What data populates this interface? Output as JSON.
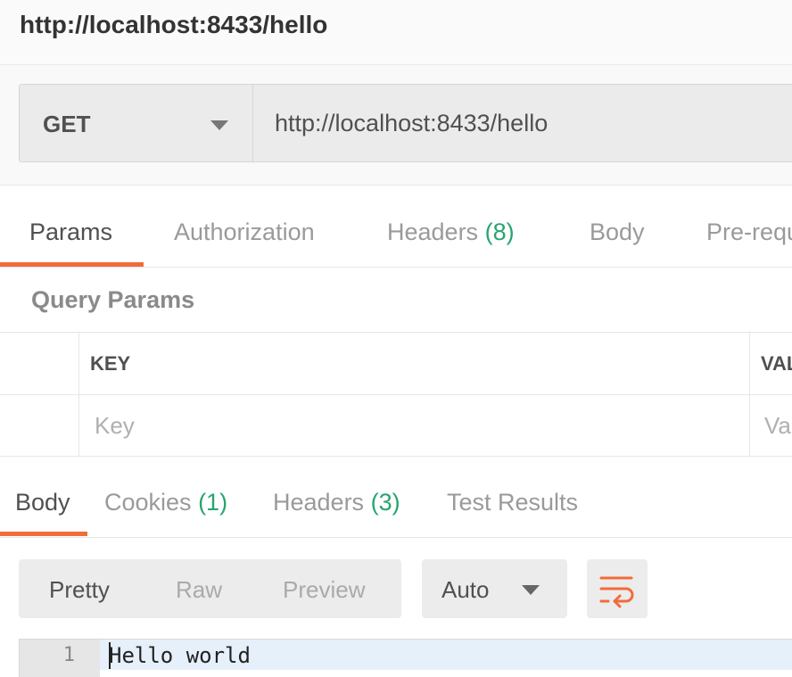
{
  "window": {
    "title": "http://localhost:8433/hello"
  },
  "request": {
    "method": "GET",
    "url": "http://localhost:8433/hello"
  },
  "request_tabs": [
    {
      "label": "Params",
      "count": "",
      "active": true
    },
    {
      "label": "Authorization",
      "count": "",
      "active": false
    },
    {
      "label": "Headers",
      "count": "(8)",
      "active": false
    },
    {
      "label": "Body",
      "count": "",
      "active": false
    },
    {
      "label": "Pre-requ",
      "count": "",
      "active": false
    }
  ],
  "query_params": {
    "title": "Query Params",
    "columns": [
      "KEY",
      "VAL"
    ],
    "placeholder_row": [
      "Key",
      "Va"
    ]
  },
  "response_tabs": [
    {
      "label": "Body",
      "count": "",
      "active": true
    },
    {
      "label": "Cookies",
      "count": "(1)",
      "active": false
    },
    {
      "label": "Headers",
      "count": "(3)",
      "active": false
    },
    {
      "label": "Test Results",
      "count": "",
      "active": false
    }
  ],
  "response_toolbar": {
    "view_modes": [
      "Pretty",
      "Raw",
      "Preview"
    ],
    "active_view": "Pretty",
    "format": "Auto",
    "wrap_icon": "wrap-lines-icon"
  },
  "response_body": {
    "lines": [
      {
        "number": "1",
        "text": "Hello world"
      }
    ]
  },
  "colors": {
    "accent": "#f26b3a",
    "count_green": "#27a56f"
  }
}
